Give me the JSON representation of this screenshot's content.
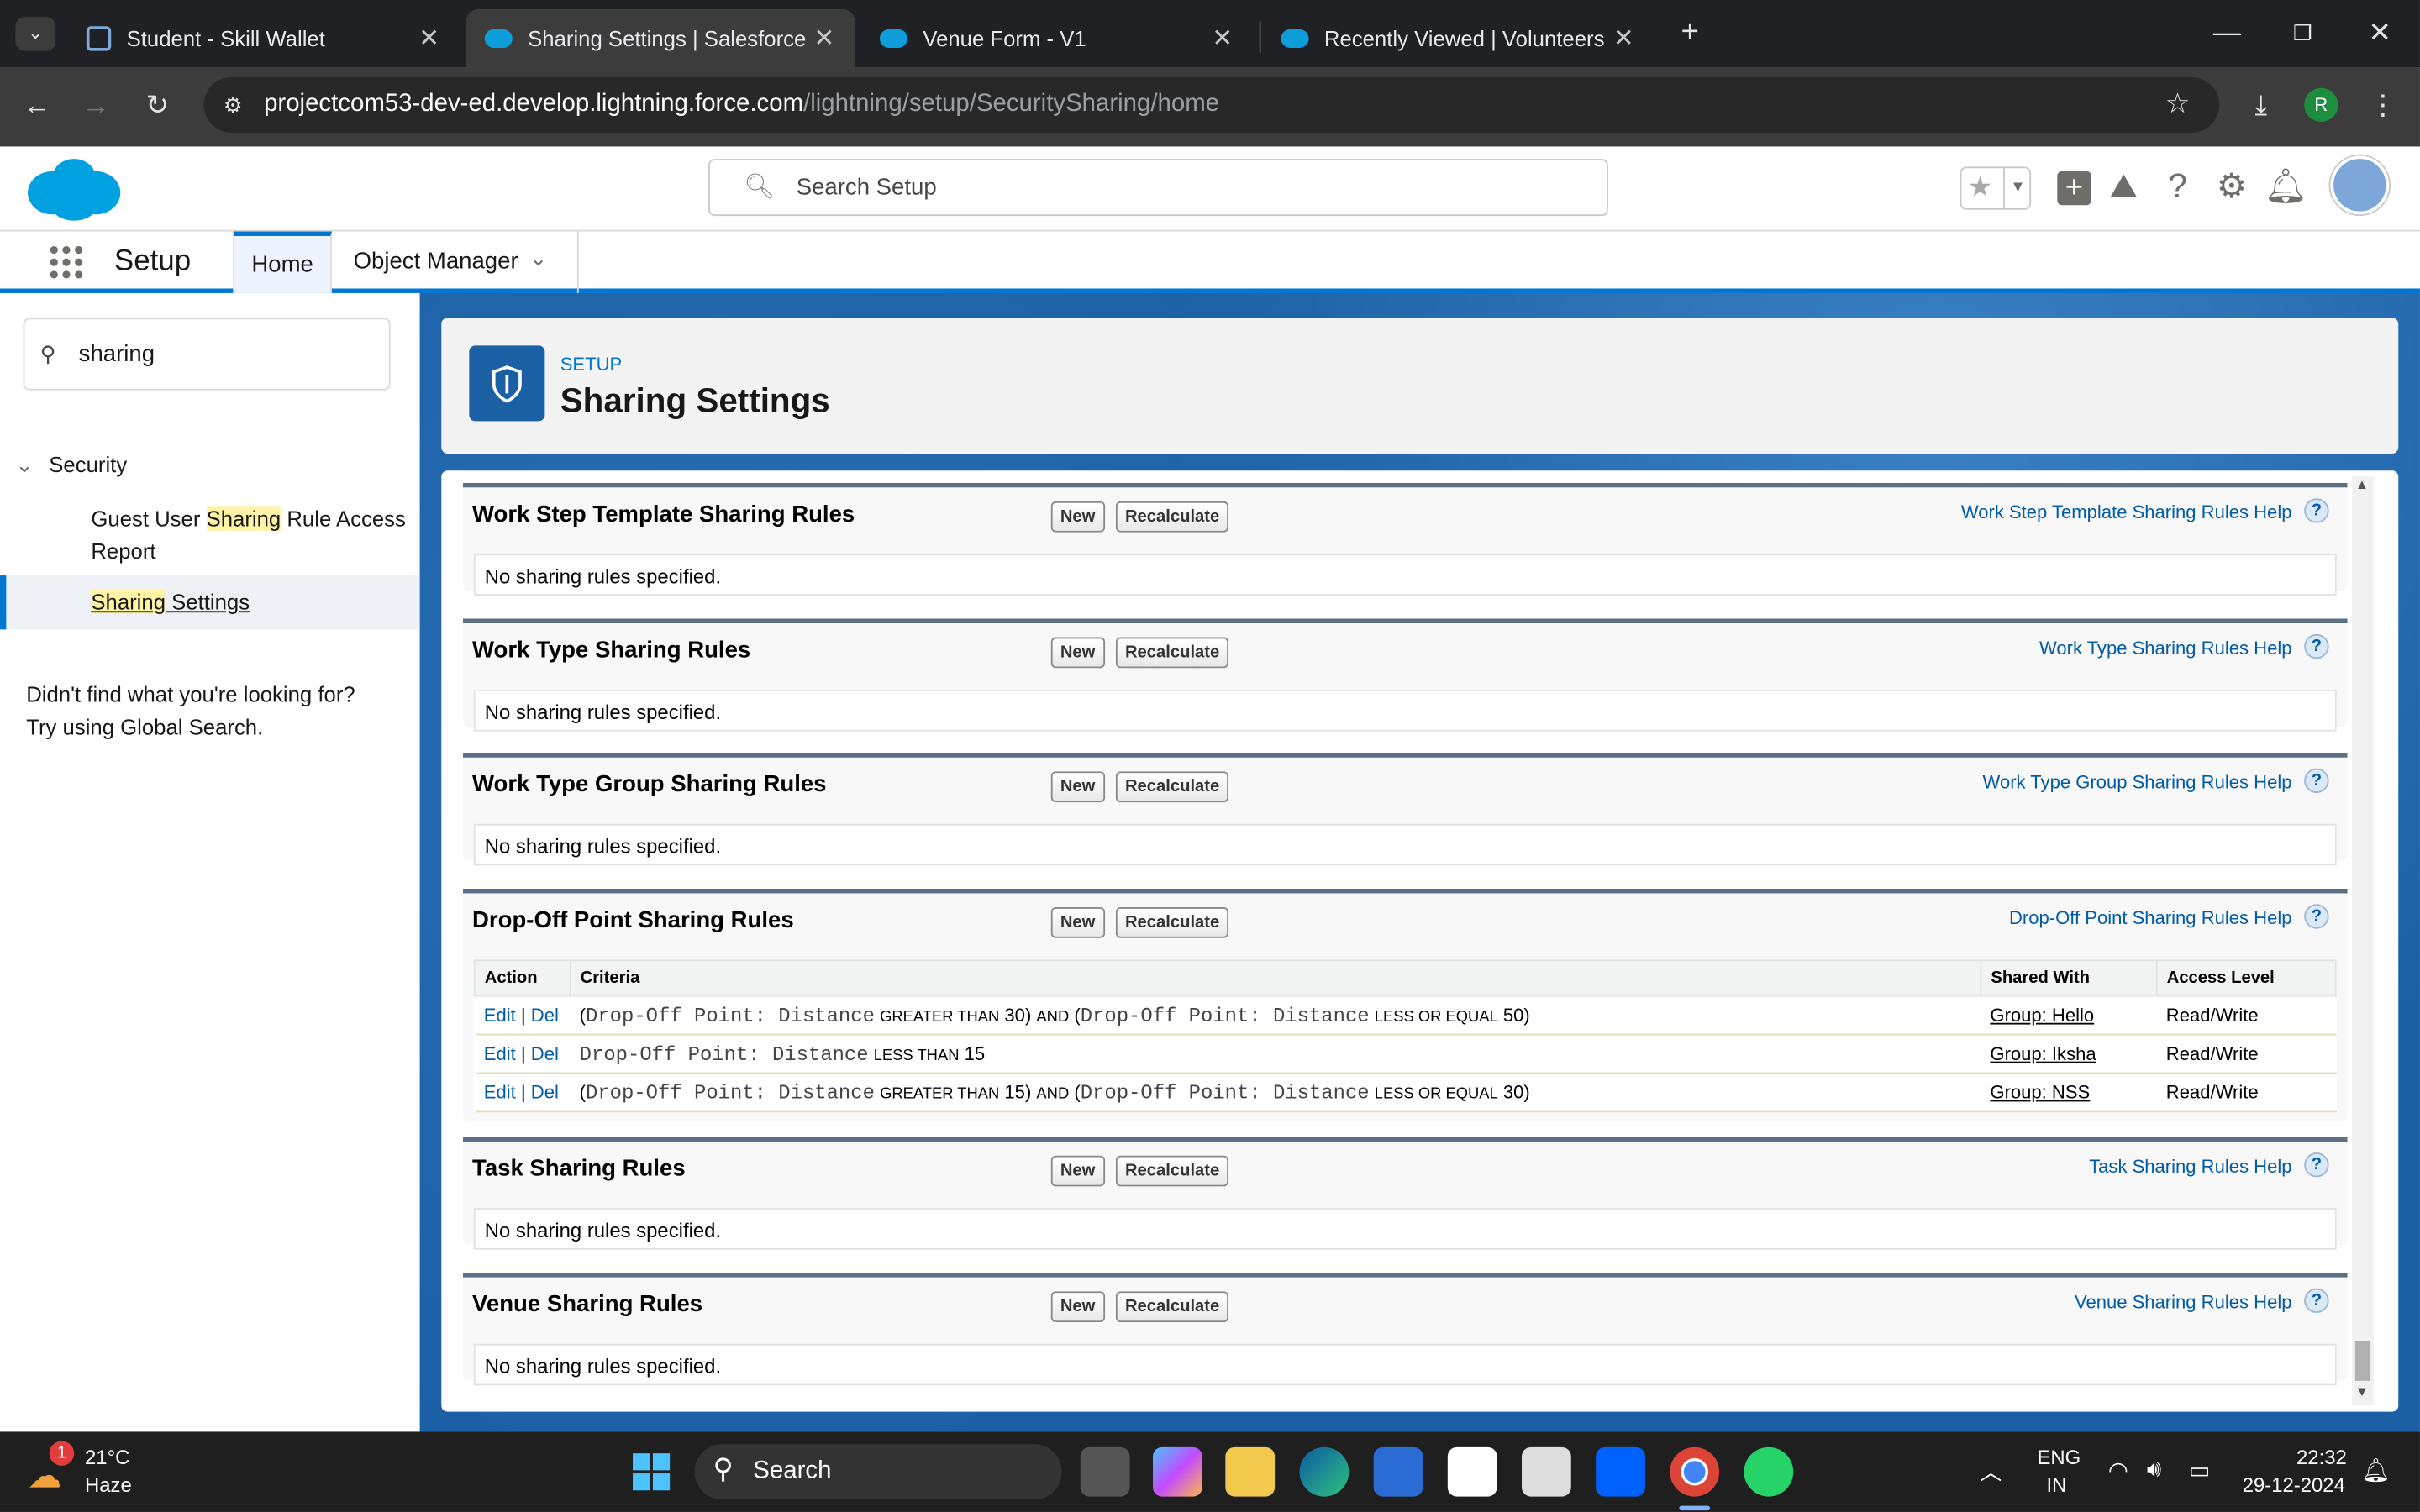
{
  "browser": {
    "tabs": [
      {
        "title": "Student - Skill Wallet",
        "active": false
      },
      {
        "title": "Sharing Settings | Salesforce",
        "active": true
      },
      {
        "title": "Venue Form - V1",
        "active": false
      },
      {
        "title": "Recently Viewed | Volunteers | S",
        "active": false
      }
    ],
    "url_host": "projectcom53-dev-ed.develop.lightning.force.com",
    "url_path": "/lightning/setup/SecuritySharing/home",
    "profile_initial": "R"
  },
  "header": {
    "search_placeholder": "Search Setup"
  },
  "nav": {
    "app": "Setup",
    "home": "Home",
    "object_manager": "Object Manager"
  },
  "sidebar": {
    "search_value": "sharing",
    "group": "Security",
    "item1_pre": "Guest User ",
    "item1_hl": "Sharing",
    "item1_post": " Rule Access",
    "item1_line2": "Report",
    "item2_hl": "Sharing",
    "item2_post": " Settings",
    "help_line1": "Didn't find what you're looking for?",
    "help_line2": "Try using Global Search."
  },
  "page": {
    "eyebrow": "SETUP",
    "title": "Sharing Settings"
  },
  "buttons": {
    "new": "New",
    "recalculate": "Recalculate"
  },
  "empty_text": "No sharing rules specified.",
  "sections": {
    "work_step": {
      "title": "Work Step Template Sharing Rules",
      "help": "Work Step Template Sharing Rules Help"
    },
    "work_type": {
      "title": "Work Type Sharing Rules",
      "help": "Work Type Sharing Rules Help"
    },
    "work_type_group": {
      "title": "Work Type Group Sharing Rules",
      "help": "Work Type Group Sharing Rules Help"
    },
    "dropoff": {
      "title": "Drop-Off Point Sharing Rules",
      "help": "Drop-Off Point Sharing Rules Help"
    },
    "task": {
      "title": "Task Sharing Rules",
      "help": "Task Sharing Rules Help"
    },
    "venue": {
      "title": "Venue Sharing Rules",
      "help": "Venue Sharing Rules Help"
    }
  },
  "dropoff_table": {
    "headers": {
      "action": "Action",
      "criteria": "Criteria",
      "shared_with": "Shared With",
      "access": "Access Level"
    },
    "edit": "Edit",
    "del": "Del",
    "field": "Drop-Off Point: Distance",
    "rows": [
      {
        "op1": "GREATER THAN",
        "v1": "30",
        "and": "AND",
        "op2": "LESS OR EQUAL",
        "v2": "50",
        "shared": "Group: Hello",
        "access": "Read/Write"
      },
      {
        "op1": "LESS THAN",
        "v1": "15",
        "shared": "Group: Iksha",
        "access": "Read/Write"
      },
      {
        "op1": "GREATER THAN",
        "v1": "15",
        "and": "AND",
        "op2": "LESS OR EQUAL",
        "v2": "30",
        "shared": "Group: NSS",
        "access": "Read/Write"
      }
    ]
  },
  "taskbar": {
    "temp": "21°C",
    "weather": "Haze",
    "badge": "1",
    "search": "Search",
    "lang1": "ENG",
    "lang2": "IN",
    "time": "22:32",
    "date": "29-12-2024"
  }
}
